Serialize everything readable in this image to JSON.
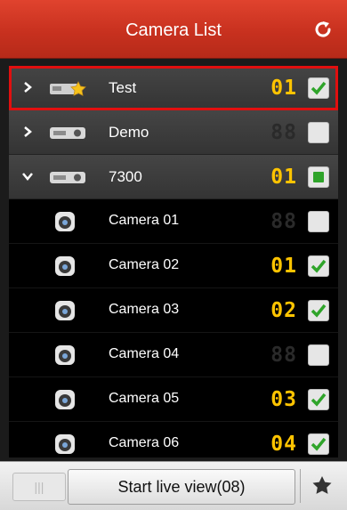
{
  "header": {
    "title": "Camera List"
  },
  "groups": [
    {
      "name": "Test",
      "channel": "01",
      "expanded": false
    },
    {
      "name": "Demo",
      "channel": "88",
      "expanded": false
    },
    {
      "name": "7300",
      "channel": "01",
      "expanded": true
    }
  ],
  "cameras": [
    {
      "name": "Camera 01",
      "channel": "88"
    },
    {
      "name": "Camera 02",
      "channel": "01"
    },
    {
      "name": "Camera 03",
      "channel": "02"
    },
    {
      "name": "Camera 04",
      "channel": "88"
    },
    {
      "name": "Camera 05",
      "channel": "03"
    },
    {
      "name": "Camera 06",
      "channel": "04"
    }
  ],
  "footer": {
    "handle": "|||",
    "start_label": "Start live view(08)"
  },
  "colors": {
    "accent": "#c8311f",
    "digits": "#ffc400",
    "check": "#2fa42a",
    "highlight": "#e10f0f"
  },
  "icons": [
    "refresh-icon",
    "chevron-right-icon",
    "chevron-down-icon",
    "device-icon",
    "camera-icon",
    "star-icon"
  ]
}
